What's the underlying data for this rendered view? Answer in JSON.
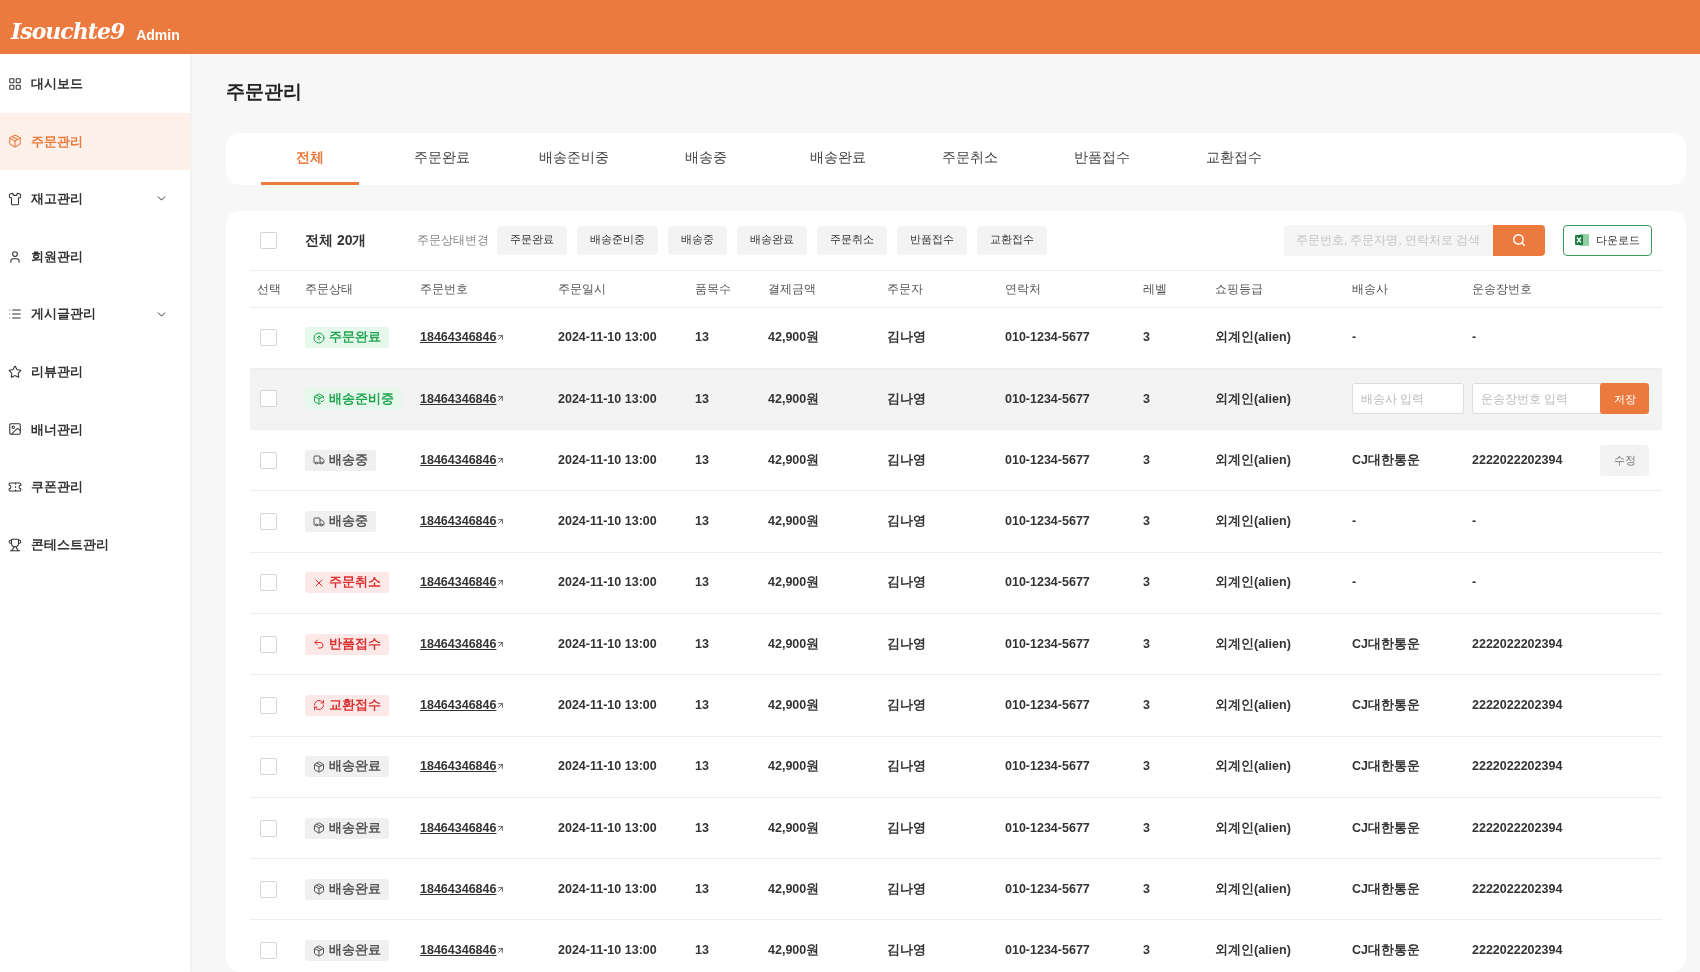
{
  "header": {
    "logo": "Isouchte9",
    "badge": "Admin"
  },
  "sidebar": {
    "items": [
      {
        "label": "대시보드",
        "selected": false,
        "expandable": false
      },
      {
        "label": "주문관리",
        "selected": true,
        "expandable": false
      },
      {
        "label": "재고관리",
        "selected": false,
        "expandable": true
      },
      {
        "label": "회원관리",
        "selected": false,
        "expandable": false
      },
      {
        "label": "게시글관리",
        "selected": false,
        "expandable": true
      },
      {
        "label": "리뷰관리",
        "selected": false,
        "expandable": false
      },
      {
        "label": "배너관리",
        "selected": false,
        "expandable": false
      },
      {
        "label": "쿠폰관리",
        "selected": false,
        "expandable": false
      },
      {
        "label": "콘테스트관리",
        "selected": false,
        "expandable": false
      }
    ]
  },
  "page_title": "주문관리",
  "tabs": [
    {
      "label": "전체",
      "selected": true
    },
    {
      "label": "주문완료",
      "selected": false
    },
    {
      "label": "배송준비중",
      "selected": false
    },
    {
      "label": "배송중",
      "selected": false
    },
    {
      "label": "배송완료",
      "selected": false
    },
    {
      "label": "주문취소",
      "selected": false
    },
    {
      "label": "반품접수",
      "selected": false
    },
    {
      "label": "교환접수",
      "selected": false
    }
  ],
  "toolbar": {
    "select_all_checked": false,
    "total": "전체 20개",
    "change_label": "주문상태변경",
    "status_buttons": [
      "주문완료",
      "배송준비중",
      "배송중",
      "배송완료",
      "주문취소",
      "반품접수",
      "교환접수"
    ],
    "search_placeholder": "주문번호, 주문자명, 연락처로 검색",
    "download": "다운로드"
  },
  "table": {
    "columns": [
      "선택",
      "주문상태",
      "주문번호",
      "주문일시",
      "품목수",
      "결제금액",
      "주문자",
      "연락처",
      "레벨",
      "쇼핑등급",
      "배송사",
      "운송장번호"
    ],
    "rows": [
      {
        "checked": false,
        "highlighted": false,
        "status": {
          "kind": "complete",
          "label": "주문완료"
        },
        "order_no": "18464346846",
        "date": "2024-11-10 13:00",
        "items": "13",
        "amount": "42,900원",
        "buyer": "김나영",
        "phone": "010-1234-5677",
        "level": "3",
        "grade": "외계인(alien)",
        "shipping": {
          "kind": "text",
          "carrier": "-",
          "tracking": "-"
        }
      },
      {
        "checked": false,
        "highlighted": true,
        "status": {
          "kind": "preparing",
          "label": "배송준비중"
        },
        "order_no": "18464346846",
        "date": "2024-11-10 13:00",
        "items": "13",
        "amount": "42,900원",
        "buyer": "김나영",
        "phone": "010-1234-5677",
        "level": "3",
        "grade": "외계인(alien)",
        "shipping": {
          "kind": "input",
          "carrier_placeholder": "배송사 입력",
          "tracking_placeholder": "운송장번호 입력",
          "button": "저장"
        }
      },
      {
        "checked": false,
        "highlighted": false,
        "status": {
          "kind": "shipping",
          "label": "배송중"
        },
        "order_no": "18464346846",
        "date": "2024-11-10 13:00",
        "items": "13",
        "amount": "42,900원",
        "buyer": "김나영",
        "phone": "010-1234-5677",
        "level": "3",
        "grade": "외계인(alien)",
        "shipping": {
          "kind": "text",
          "carrier": "CJ대한통운",
          "tracking": "2222022202394",
          "button": "수정"
        }
      },
      {
        "checked": false,
        "highlighted": false,
        "status": {
          "kind": "shipping",
          "label": "배송중"
        },
        "order_no": "18464346846",
        "date": "2024-11-10 13:00",
        "items": "13",
        "amount": "42,900원",
        "buyer": "김나영",
        "phone": "010-1234-5677",
        "level": "3",
        "grade": "외계인(alien)",
        "shipping": {
          "kind": "text",
          "carrier": "-",
          "tracking": "-"
        }
      },
      {
        "checked": false,
        "highlighted": false,
        "status": {
          "kind": "cancelled",
          "label": "주문취소"
        },
        "order_no": "18464346846",
        "date": "2024-11-10 13:00",
        "items": "13",
        "amount": "42,900원",
        "buyer": "김나영",
        "phone": "010-1234-5677",
        "level": "3",
        "grade": "외계인(alien)",
        "shipping": {
          "kind": "text",
          "carrier": "-",
          "tracking": "-"
        }
      },
      {
        "checked": false,
        "highlighted": false,
        "status": {
          "kind": "return",
          "label": "반품접수"
        },
        "order_no": "18464346846",
        "date": "2024-11-10 13:00",
        "items": "13",
        "amount": "42,900원",
        "buyer": "김나영",
        "phone": "010-1234-5677",
        "level": "3",
        "grade": "외계인(alien)",
        "shipping": {
          "kind": "text",
          "carrier": "CJ대한통운",
          "tracking": "2222022202394"
        }
      },
      {
        "checked": false,
        "highlighted": false,
        "status": {
          "kind": "exchange",
          "label": "교환접수"
        },
        "order_no": "18464346846",
        "date": "2024-11-10 13:00",
        "items": "13",
        "amount": "42,900원",
        "buyer": "김나영",
        "phone": "010-1234-5677",
        "level": "3",
        "grade": "외계인(alien)",
        "shipping": {
          "kind": "text",
          "carrier": "CJ대한통운",
          "tracking": "2222022202394"
        }
      },
      {
        "checked": false,
        "highlighted": false,
        "status": {
          "kind": "delivered",
          "label": "배송완료"
        },
        "order_no": "18464346846",
        "date": "2024-11-10 13:00",
        "items": "13",
        "amount": "42,900원",
        "buyer": "김나영",
        "phone": "010-1234-5677",
        "level": "3",
        "grade": "외계인(alien)",
        "shipping": {
          "kind": "text",
          "carrier": "CJ대한통운",
          "tracking": "2222022202394"
        }
      },
      {
        "checked": false,
        "highlighted": false,
        "status": {
          "kind": "delivered",
          "label": "배송완료"
        },
        "order_no": "18464346846",
        "date": "2024-11-10 13:00",
        "items": "13",
        "amount": "42,900원",
        "buyer": "김나영",
        "phone": "010-1234-5677",
        "level": "3",
        "grade": "외계인(alien)",
        "shipping": {
          "kind": "text",
          "carrier": "CJ대한통운",
          "tracking": "2222022202394"
        }
      },
      {
        "checked": false,
        "highlighted": false,
        "status": {
          "kind": "delivered",
          "label": "배송완료"
        },
        "order_no": "18464346846",
        "date": "2024-11-10 13:00",
        "items": "13",
        "amount": "42,900원",
        "buyer": "김나영",
        "phone": "010-1234-5677",
        "level": "3",
        "grade": "외계인(alien)",
        "shipping": {
          "kind": "text",
          "carrier": "CJ대한통운",
          "tracking": "2222022202394"
        }
      },
      {
        "checked": false,
        "highlighted": false,
        "status": {
          "kind": "delivered",
          "label": "배송완료"
        },
        "order_no": "18464346846",
        "date": "2024-11-10 13:00",
        "items": "13",
        "amount": "42,900원",
        "buyer": "김나영",
        "phone": "010-1234-5677",
        "level": "3",
        "grade": "외계인(alien)",
        "shipping": {
          "kind": "text",
          "carrier": "CJ대한통운",
          "tracking": "2222022202394"
        }
      }
    ]
  }
}
